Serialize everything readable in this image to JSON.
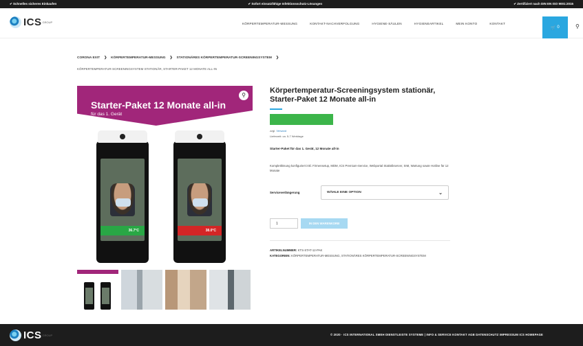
{
  "topbar": {
    "left": "✔ Schnelles sicheres Einkaufen",
    "center": "✔ Sofort einsatzfähige Infektionsschutz-Lösungen",
    "right": "✔ Zertifiziert nach DIN EN ISO 9001:2015"
  },
  "header": {
    "logo_text": "ICS",
    "logo_sup": "GROUP",
    "nav": [
      "KÖRPERTEMPERATUR-MESSUNG",
      "KONTAKT-NACHVERFOLGUNG",
      "HYGIENE-SÄULEN",
      "HYGIENEARTIKEL",
      "MEIN KONTO",
      "KONTAKT"
    ],
    "cart_label": "0"
  },
  "breadcrumb": {
    "items": [
      "CORONA EXIT",
      "KÖRPERTEMPERATUR-MESSUNG",
      "STATIONÄRES KÖRPERTEMPERATUR-SCREENINGSYSTEM"
    ],
    "separator": "❯",
    "current": "KÖRPERTEMPERATUR-SCREENINGSYSTEM STATIONÄR, STARTER-PAKET 12 MONATE ALL-IN"
  },
  "gallery": {
    "banner_title": "Starter-Paket 12 Monate all-in",
    "banner_sub": "für das 1. Gerät",
    "device_left_temp": "36.7°C",
    "device_right_temp": "38.0°C"
  },
  "product": {
    "title": "Körpertemperatur-Screeningsystem stationär, Starter-Paket 12 Monate all-in",
    "tax_prefix": "zzgl.",
    "tax_link": "Versand",
    "delivery": "Lieferzeit: ca. 5-7 Werktage",
    "short_desc_title": "Starter-Paket für das 1. Gerät, 12 Monate all-in",
    "short_desc": "Komplettlösung konfiguriert inkl. Firmensetup, MDM, ICS Premium-Service, Webportal Statistikserver, SIM, Wartung sowie Hotline für 12 Monate",
    "option_label": "Serviceverlängerung",
    "option_value": "WÄHLE EINE OPTION",
    "qty": "1",
    "add_to_cart": "IN DEN WARENKORB",
    "sku_label": "ARTIKELNUMMER:",
    "sku_value": "KTS-STAT-12-PAK",
    "cat_label": "KATEGORIEN:",
    "cat_value": "KÖRPERTEMPERATUR-MESSUNG, STATIONÄRES KÖRPERTEMPERATUR-SCREENINGSYSTEM"
  },
  "footer": {
    "logo_text": "ICS",
    "logo_sup": "GROUP",
    "links": "© 2020 · ICS INTERNATIONAL SMEH DIENSTLEISTE SYSTEME | INFO & SERVICE KONTAKT AGB DATENSCHUTZ IMPRESSUM ICS HOMEPAGE"
  },
  "colors": {
    "accent": "#2aa7e0",
    "banner": "#a1267a",
    "price": "#3cb54a",
    "dark": "#1d1d1d"
  },
  "icons": [
    "shield-check-icon",
    "cart-icon",
    "search-icon",
    "zoom-icon",
    "chevron-down-icon"
  ]
}
